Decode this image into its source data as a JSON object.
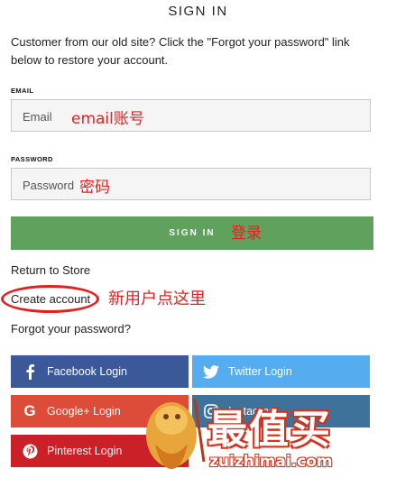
{
  "page": {
    "title": "SIGN IN",
    "intro": "Customer from our old site? Click the \"Forgot your password\" link below to restore your account."
  },
  "form": {
    "email_label": "EMAIL",
    "email_placeholder": "Email",
    "email_note": "email账号",
    "password_label": "PASSWORD",
    "password_placeholder": "Password",
    "password_note": "密码",
    "signin_label": "SIGN IN",
    "signin_note": "登录"
  },
  "links": {
    "return": "Return to Store",
    "create": "Create account",
    "create_note": "新用户点这里",
    "forgot": "Forgot your password?"
  },
  "social": {
    "facebook": "Facebook Login",
    "twitter": "Twitter Login",
    "google": "Google+ Login",
    "instagram": "Instagram",
    "pinterest": "Pinterest Login"
  },
  "watermark": {
    "text": "最值买",
    "url": "zuizhimai.com"
  },
  "colors": {
    "facebook": "#3b5998",
    "twitter": "#55acee",
    "google": "#dd4b39",
    "instagram": "#3f729b",
    "pinterest": "#cb2027",
    "signin": "#5fa15d",
    "annotation": "#e62020"
  }
}
